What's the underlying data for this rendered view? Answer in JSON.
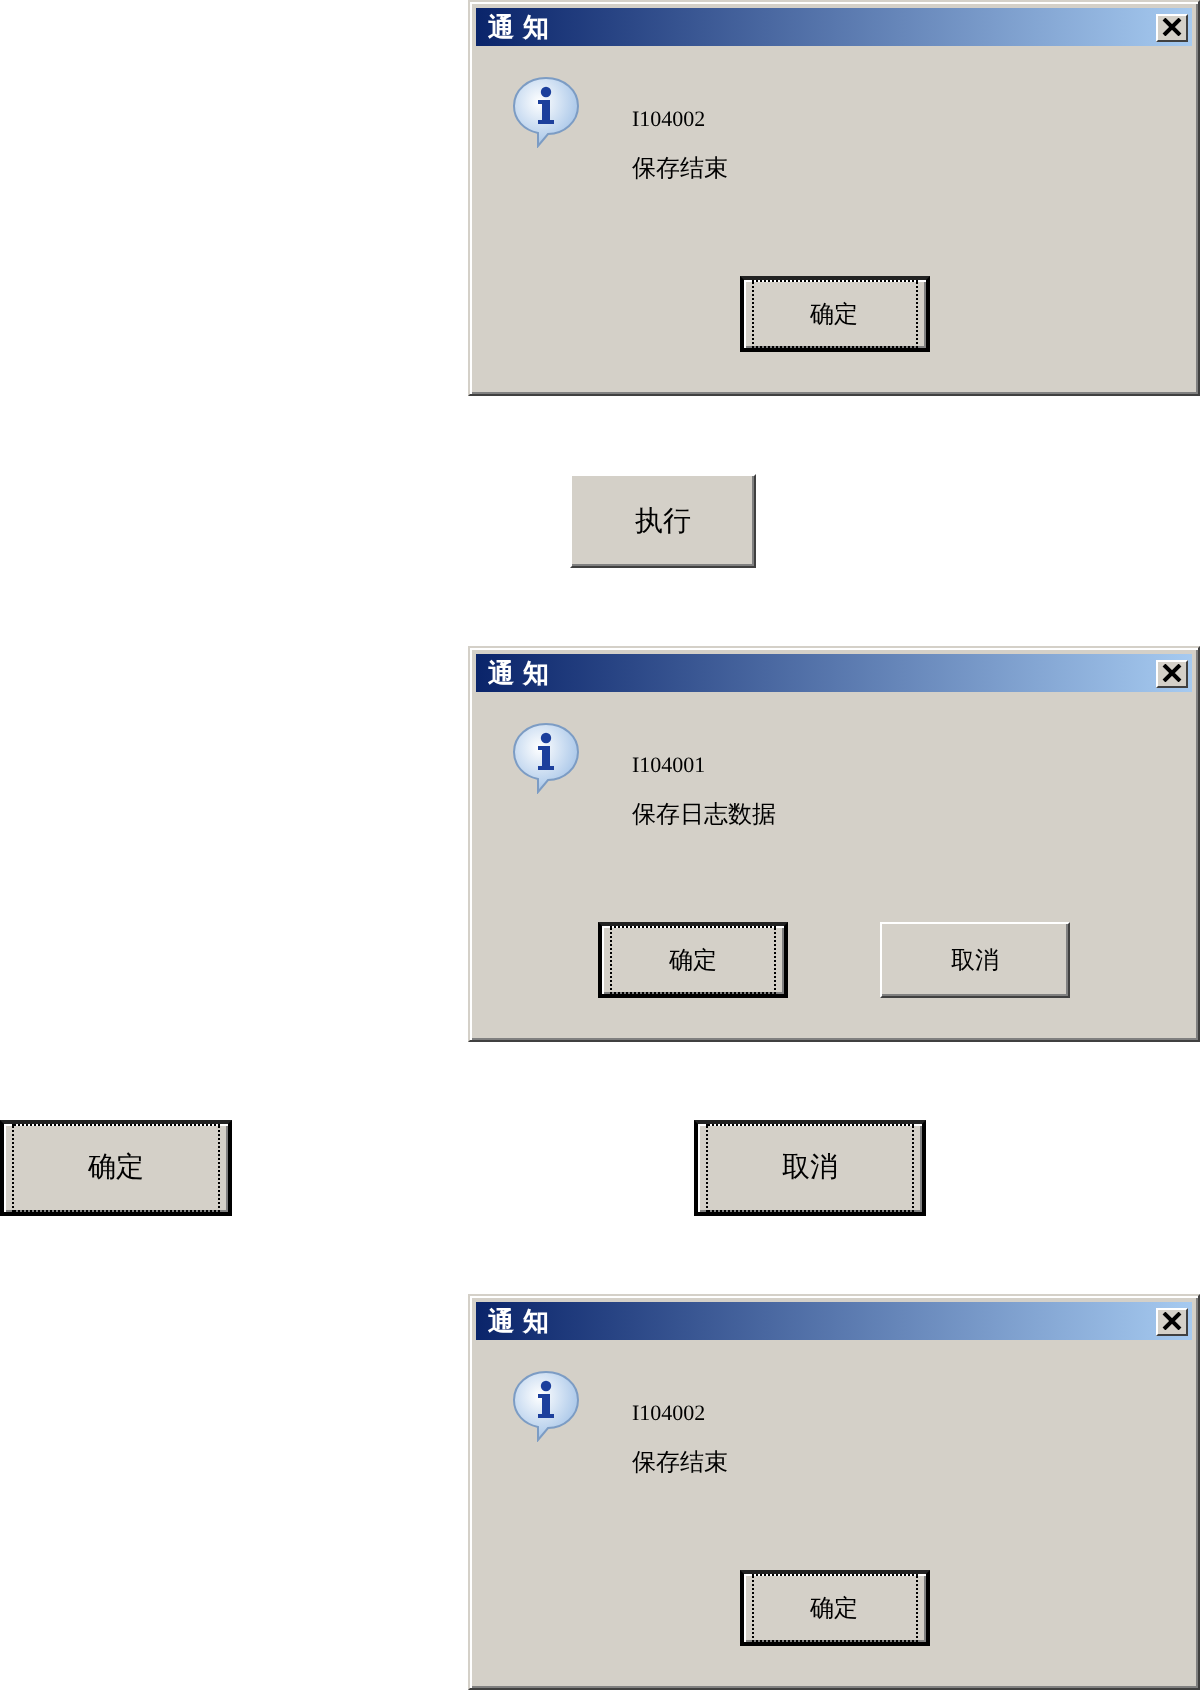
{
  "items": [
    {
      "kind": "dialog",
      "title": "通 知",
      "code": "I104002",
      "message": "保存结束",
      "buttons": [
        {
          "label": "确定",
          "focused": true
        }
      ]
    },
    {
      "kind": "button_row",
      "buttons": [
        {
          "label": "执行",
          "focused": false
        }
      ]
    },
    {
      "kind": "dialog",
      "title": "通 知",
      "code": "I104001",
      "message": "保存日志数据",
      "buttons": [
        {
          "label": "确定",
          "focused": true
        },
        {
          "label": "取消",
          "focused": false
        }
      ]
    },
    {
      "kind": "button_row",
      "buttons": [
        {
          "label": "确定",
          "focused": true
        },
        {
          "label": "取消",
          "focused": true
        }
      ]
    },
    {
      "kind": "dialog",
      "title": "通 知",
      "code": "I104002",
      "message": "保存结束",
      "buttons": [
        {
          "label": "确定",
          "focused": true
        }
      ]
    }
  ]
}
